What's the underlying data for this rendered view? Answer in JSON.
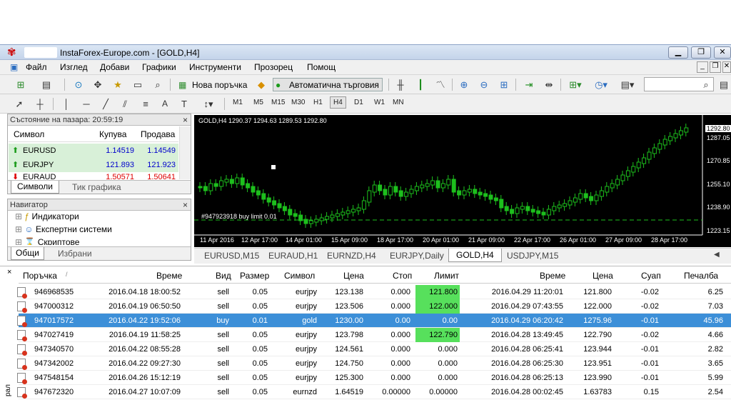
{
  "window": {
    "title": "InstaForex-Europe.com - [GOLD,H4]"
  },
  "menu": [
    "Файл",
    "Изглед",
    "Добави",
    "Графики",
    "Инструменти",
    "Прозорец",
    "Помощ"
  ],
  "toolbar": {
    "new_order": "Нова поръчка",
    "auto_trading": "Автоматична търговия"
  },
  "timeframes": [
    "M1",
    "M5",
    "M15",
    "M30",
    "H1",
    "H4",
    "D1",
    "W1",
    "MN"
  ],
  "market_watch": {
    "title": "Състояние на пазара: 20:59:19",
    "columns": [
      "Символ",
      "Купува",
      "Продава"
    ],
    "rows": [
      {
        "symbol": "EURUSD",
        "bid": "1.14519",
        "ask": "1.14549"
      },
      {
        "symbol": "EURJPY",
        "bid": "121.893",
        "ask": "121.923"
      },
      {
        "symbol": "EURAUD",
        "bid": "1.50571",
        "ask": "1.50641"
      }
    ],
    "tabs": [
      "Символи",
      "Тик графика"
    ]
  },
  "navigator": {
    "title": "Навигатор",
    "items": [
      "Индикатори",
      "Експертни системи",
      "Скриптове"
    ],
    "tabs": [
      "Общи",
      "Избрани"
    ]
  },
  "chart": {
    "header": "GOLD,H4  1290.37 1294.63 1289.53 1292.80",
    "order_label": "#947923918 buy limit 0.01",
    "price_labels": [
      "1292.80",
      "1287.05",
      "1270.85",
      "1255.10",
      "1238.90",
      "1223.15"
    ],
    "time_labels": [
      "11 Apr 2016",
      "12 Apr 17:00",
      "14 Apr 01:00",
      "15 Apr 09:00",
      "18 Apr 17:00",
      "20 Apr 01:00",
      "21 Apr 09:00",
      "22 Apr 17:00",
      "26 Apr 01:00",
      "27 Apr 09:00",
      "28 Apr 17:00"
    ]
  },
  "chart_tabs": [
    "EURUSD,M15",
    "EURAUD,H1",
    "EURNZD,H4",
    "EURJPY,Daily",
    "GOLD,H4",
    "USDJPY,M15"
  ],
  "orders": {
    "columns": [
      "Поръчка",
      "Време",
      "Вид",
      "Размер",
      "Символ",
      "Цена",
      "Стоп",
      "Лимит",
      "Време",
      "Цена",
      "Суап",
      "Печалба"
    ],
    "rows": [
      [
        "946968535",
        "2016.04.18 18:00:52",
        "sell",
        "0.05",
        "eurjpy",
        "123.138",
        "0.000",
        "121.800",
        "2016.04.29 11:20:01",
        "121.800",
        "-0.02",
        "6.25"
      ],
      [
        "947000312",
        "2016.04.19 06:50:50",
        "sell",
        "0.05",
        "eurjpy",
        "123.506",
        "0.000",
        "122.000",
        "2016.04.29 07:43:55",
        "122.000",
        "-0.02",
        "7.03"
      ],
      [
        "947017572",
        "2016.04.22 19:52:06",
        "buy",
        "0.01",
        "gold",
        "1230.00",
        "0.00",
        "0.00",
        "2016.04.29 06:20:42",
        "1275.96",
        "-0.01",
        "45.96"
      ],
      [
        "947027419",
        "2016.04.19 11:58:25",
        "sell",
        "0.05",
        "eurjpy",
        "123.798",
        "0.000",
        "122.790",
        "2016.04.28 13:49:45",
        "122.790",
        "-0.02",
        "4.66"
      ],
      [
        "947340570",
        "2016.04.22 08:55:28",
        "sell",
        "0.05",
        "eurjpy",
        "124.561",
        "0.000",
        "0.000",
        "2016.04.28 06:25:41",
        "123.944",
        "-0.01",
        "2.82"
      ],
      [
        "947342002",
        "2016.04.22 09:27:30",
        "sell",
        "0.05",
        "eurjpy",
        "124.750",
        "0.000",
        "0.000",
        "2016.04.28 06:25:30",
        "123.951",
        "-0.01",
        "3.65"
      ],
      [
        "947548154",
        "2016.04.26 15:12:19",
        "sell",
        "0.05",
        "eurjpy",
        "125.300",
        "0.000",
        "0.000",
        "2016.04.28 06:25:13",
        "123.990",
        "-0.01",
        "5.99"
      ],
      [
        "947672320",
        "2016.04.27 10:07:09",
        "sell",
        "0.05",
        "eurnzd",
        "1.64519",
        "0.00000",
        "0.00000",
        "2016.04.28 00:02:45",
        "1.63783",
        "0.15",
        "2.54"
      ]
    ],
    "highlight_row": 2,
    "green_limit_rows": [
      0,
      1,
      3
    ]
  }
}
